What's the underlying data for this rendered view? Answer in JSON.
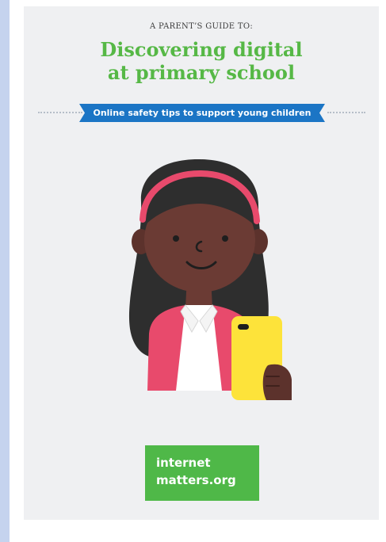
{
  "cover": {
    "kicker": "A PARENT’S GUIDE TO:",
    "title_line1": "Discovering digital",
    "title_line2": "at primary school",
    "ribbon": "Online safety tips to support young children"
  },
  "logo": {
    "line1": "internet",
    "line2": "matters.org"
  },
  "colors": {
    "title_green": "#56b846",
    "ribbon_blue": "#1b75c5",
    "logo_green": "#4fb848",
    "jacket_pink": "#e84a6c",
    "phone_yellow": "#fde33a"
  }
}
